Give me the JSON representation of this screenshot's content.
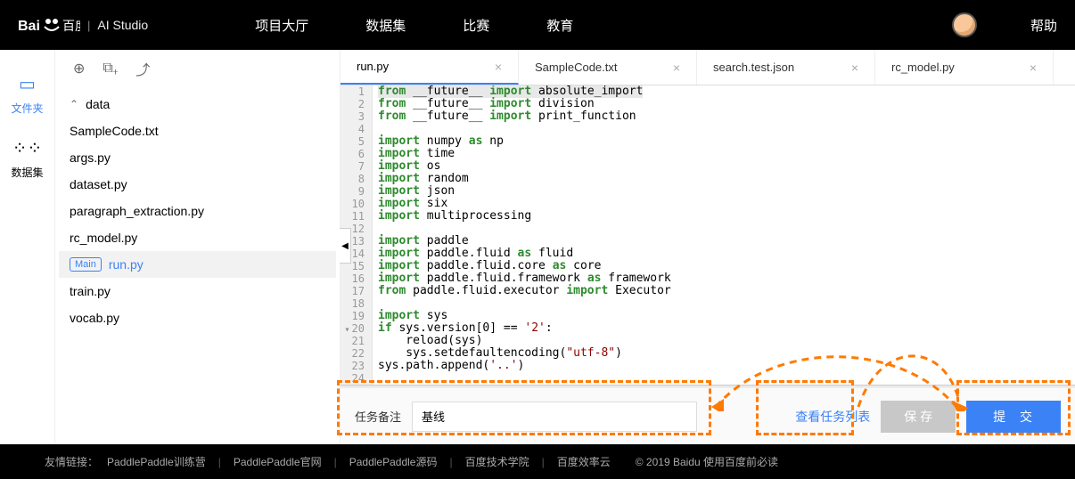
{
  "header": {
    "logo_brand": "百度",
    "logo_product": "AI Studio",
    "nav": [
      "项目大厅",
      "数据集",
      "比赛",
      "教育"
    ],
    "help": "帮助"
  },
  "rail": {
    "files": {
      "label": "文件夹"
    },
    "datasets": {
      "label": "数据集"
    }
  },
  "file_tree": {
    "folder": "data",
    "files": [
      "SampleCode.txt",
      "args.py",
      "dataset.py",
      "paragraph_extraction.py",
      "rc_model.py",
      "run.py",
      "train.py",
      "vocab.py"
    ],
    "main_badge": "Main",
    "active": "run.py"
  },
  "tabs": [
    {
      "label": "run.py",
      "active": true
    },
    {
      "label": "SampleCode.txt",
      "active": false
    },
    {
      "label": "search.test.json",
      "active": false
    },
    {
      "label": "rc_model.py",
      "active": false
    }
  ],
  "code": {
    "lines": [
      "from __future__ import absolute_import",
      "from __future__ import division",
      "from __future__ import print_function",
      "",
      "import numpy as np",
      "import time",
      "import os",
      "import random",
      "import json",
      "import six",
      "import multiprocessing",
      "",
      "import paddle",
      "import paddle.fluid as fluid",
      "import paddle.fluid.core as core",
      "import paddle.fluid.framework as framework",
      "from paddle.fluid.executor import Executor",
      "",
      "import sys",
      "if sys.version[0] == '2':",
      "    reload(sys)",
      "    sys.setdefaultencoding(\"utf-8\")",
      "sys.path.append('..')",
      ""
    ]
  },
  "bottom": {
    "label": "任务备注",
    "value": "基线",
    "view_tasks": "查看任务列表",
    "save": "保 存",
    "submit": "提 交"
  },
  "footer": {
    "label": "友情链接：",
    "links": [
      "PaddlePaddle训练营",
      "PaddlePaddle官网",
      "PaddlePaddle源码",
      "百度技术学院",
      "百度效率云"
    ],
    "copyright": "© 2019 Baidu 使用百度前必读"
  }
}
